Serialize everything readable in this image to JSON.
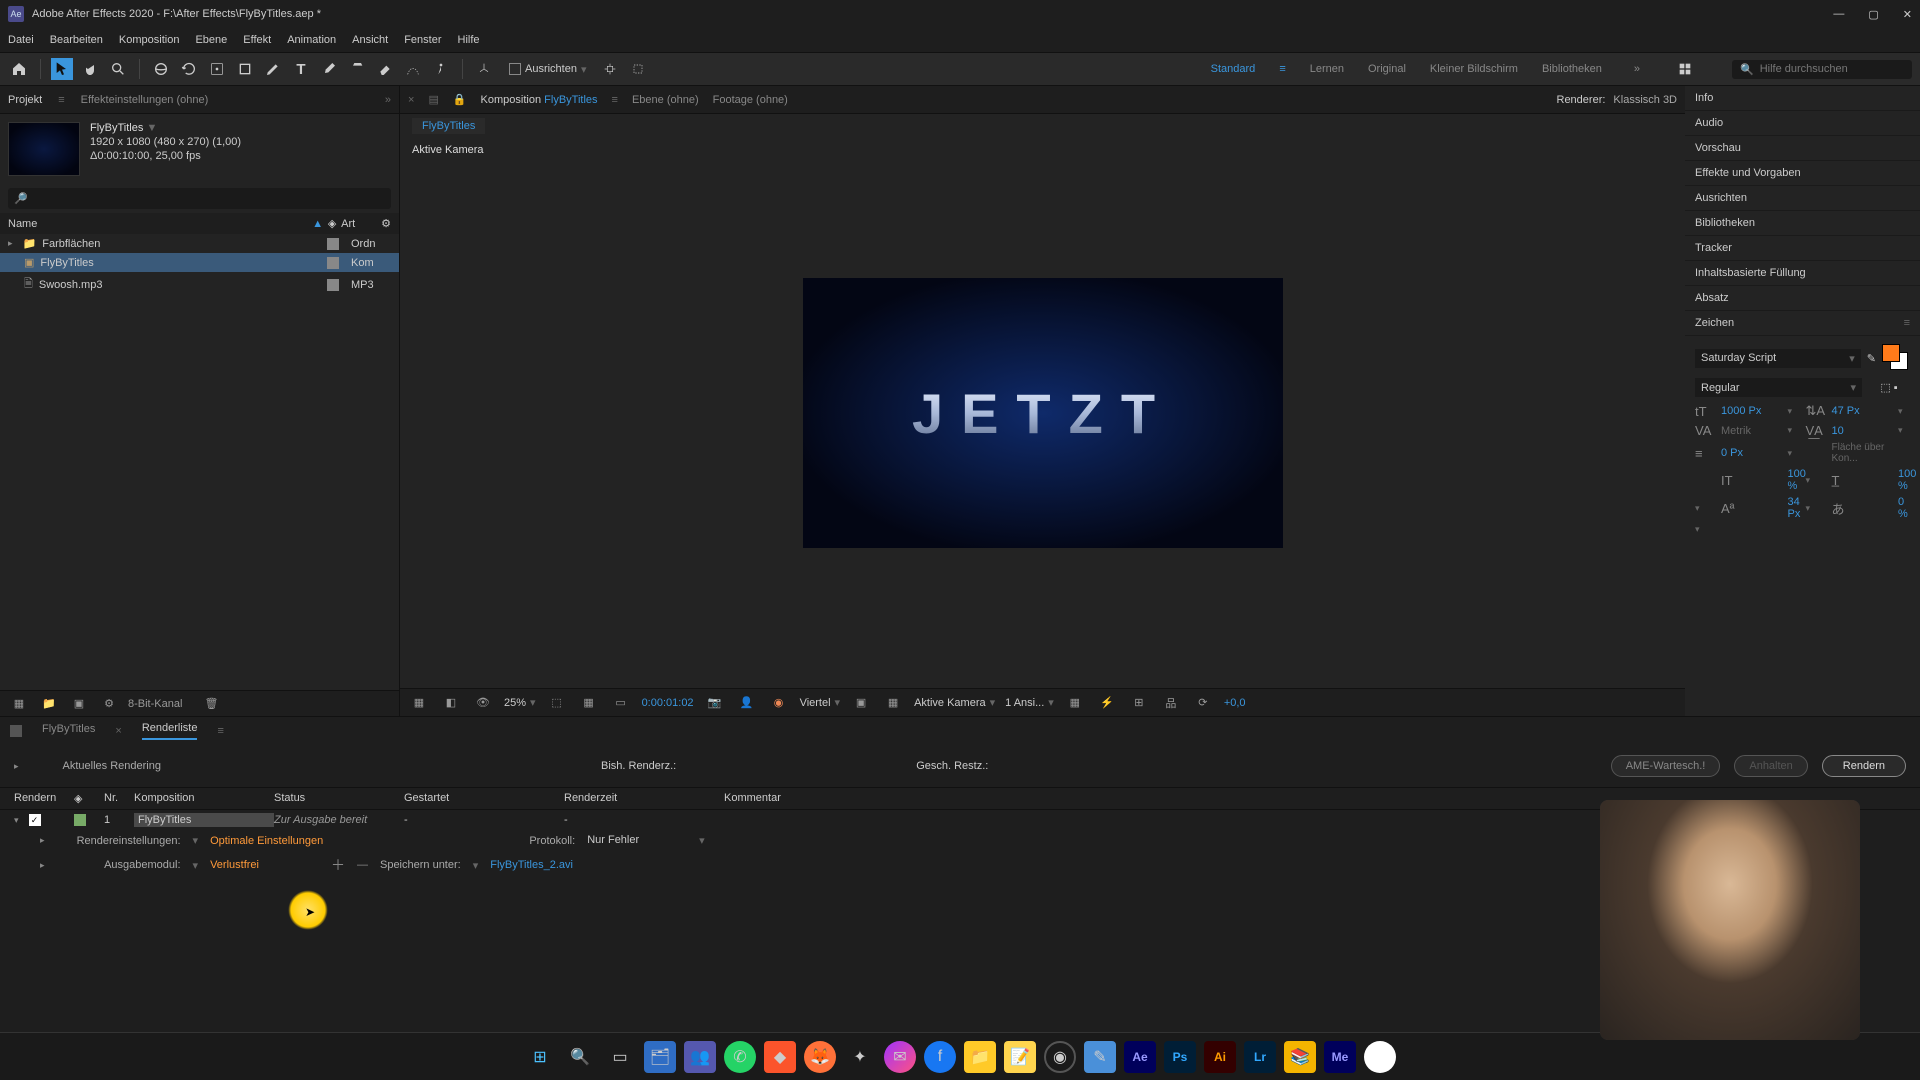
{
  "titlebar": {
    "app": "Ae",
    "title": "Adobe After Effects 2020 - F:\\After Effects\\FlyByTitles.aep *"
  },
  "menu": [
    "Datei",
    "Bearbeiten",
    "Komposition",
    "Ebene",
    "Effekt",
    "Animation",
    "Ansicht",
    "Fenster",
    "Hilfe"
  ],
  "toolbar": {
    "snap": "Ausrichten",
    "search_placeholder": "Hilfe durchsuchen"
  },
  "workspaces": {
    "active": "Standard",
    "items": [
      "Standard",
      "Lernen",
      "Original",
      "Kleiner Bildschirm",
      "Bibliotheken"
    ]
  },
  "project": {
    "tab_project": "Projekt",
    "tab_effects": "Effekteinstellungen (ohne)",
    "comp_name": "FlyByTitles",
    "comp_res": "1920 x 1080 (480 x 270) (1,00)",
    "comp_dur": "Δ0:00:10:00, 25,00 fps",
    "col_name": "Name",
    "col_type": "Art",
    "items": [
      {
        "name": "Farbflächen",
        "type": "Ordn"
      },
      {
        "name": "FlyByTitles",
        "type": "Kom"
      },
      {
        "name": "Swoosh.mp3",
        "type": "MP3"
      }
    ],
    "footer_depth": "8-Bit-Kanal"
  },
  "viewer": {
    "tab_comp_prefix": "Komposition",
    "tab_comp": "FlyByTitles",
    "tab_layer": "Ebene (ohne)",
    "tab_footage": "Footage (ohne)",
    "renderer_label": "Renderer:",
    "renderer_value": "Klassisch 3D",
    "breadcrumb": "FlyByTitles",
    "active_camera": "Aktive Kamera",
    "preview_word": "JETZT",
    "footer": {
      "zoom": "25%",
      "time": "0:00:01:02",
      "res": "Viertel",
      "cam": "Aktive Kamera",
      "views": "1 Ansi...",
      "exp": "+0,0"
    }
  },
  "rightpanels": [
    "Info",
    "Audio",
    "Vorschau",
    "Effekte und Vorgaben",
    "Ausrichten",
    "Bibliotheken",
    "Tracker",
    "Inhaltsbasierte Füllung",
    "Absatz"
  ],
  "char": {
    "title": "Zeichen",
    "font": "Saturday Script",
    "style": "Regular",
    "size": "1000 Px",
    "leading": "47 Px",
    "kerning": "Metrik",
    "tracking": "10",
    "stroke": "0 Px",
    "stroke_mode": "Fläche über Kon...",
    "vscale": "100 %",
    "hscale": "100 %",
    "baseline": "34 Px",
    "tsume": "0 %"
  },
  "bottom": {
    "tab_comp": "FlyByTitles",
    "tab_render": "Renderliste",
    "current": "Aktuelles Rendering",
    "past": "Bish. Renderz.:",
    "est": "Gesch. Restz.:",
    "ame": "AME-Wartesch.!",
    "stop": "Anhalten",
    "render": "Rendern",
    "cols": {
      "render": "Rendern",
      "nr": "Nr.",
      "comp": "Komposition",
      "status": "Status",
      "started": "Gestartet",
      "rtime": "Renderzeit",
      "comment": "Kommentar"
    },
    "row": {
      "nr": "1",
      "comp": "FlyByTitles",
      "status": "Zur Ausgabe bereit",
      "started": "-",
      "rtime": "-"
    },
    "settings_label": "Rendereinstellungen:",
    "settings_val": "Optimale Einstellungen",
    "protocol_label": "Protokoll:",
    "protocol_val": "Nur Fehler",
    "output_label": "Ausgabemodul:",
    "output_val": "Verlustfrei",
    "saveas_label": "Speichern unter:",
    "saveas_val": "FlyByTitles_2.avi"
  }
}
